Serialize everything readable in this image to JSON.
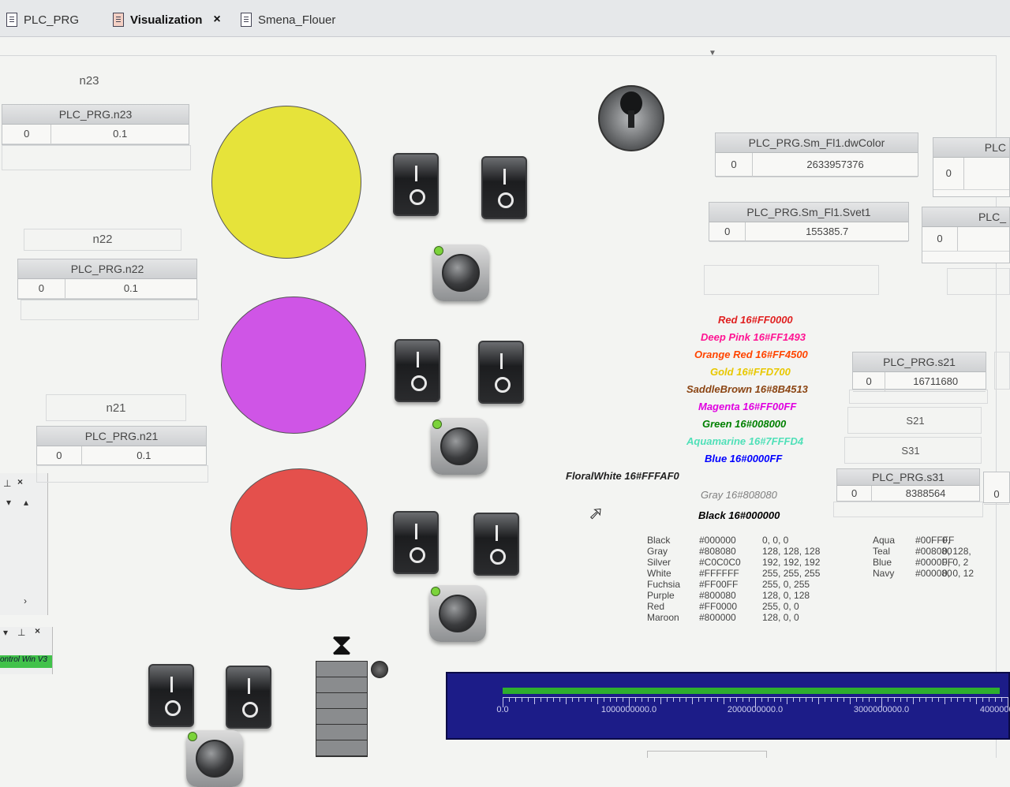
{
  "tabs": [
    {
      "label": "PLC_PRG",
      "active": false
    },
    {
      "label": "Visualization",
      "active": true
    },
    {
      "label": "Smena_Flouer",
      "active": false
    }
  ],
  "close_glyph": "×",
  "left_dock": {
    "status_text": "ontrol Win V3",
    "pin_glyph": "⊥",
    "close_glyph": "×"
  },
  "labels": {
    "n23": "n23",
    "n22": "n22",
    "n21": "n21",
    "S21": "S21",
    "S31": "S31"
  },
  "tables": {
    "n23": {
      "header": "PLC_PRG.n23",
      "index": "0",
      "value": "0.1"
    },
    "n22": {
      "header": "PLC_PRG.n22",
      "index": "0",
      "value": "0.1"
    },
    "n21": {
      "header": "PLC_PRG.n21",
      "index": "0",
      "value": "0.1"
    },
    "dwColor": {
      "header": "PLC_PRG.Sm_Fl1.dwColor",
      "index": "0",
      "value": "2633957376"
    },
    "svet1": {
      "header": "PLC_PRG.Sm_Fl1.Svet1",
      "index": "0",
      "value": "155385.7"
    },
    "s21": {
      "header": "PLC_PRG.s21",
      "index": "0",
      "value": "16711680"
    },
    "s31": {
      "header": "PLC_PRG.s31",
      "index": "0",
      "value": "8388564"
    },
    "right_top": {
      "header": "PLC",
      "index": "0"
    },
    "right_mid": {
      "header": "PLC_",
      "index": "0"
    },
    "right_low": {
      "index": "0"
    }
  },
  "lamps": {
    "colors": [
      "#e6e33a",
      "#cf55e6",
      "#e4504c"
    ]
  },
  "color_list": [
    {
      "text": "Red 16#FF0000",
      "color": "#e02020"
    },
    {
      "text": "Deep Pink  16#FF1493",
      "color": "#ff1493"
    },
    {
      "text": "Orange Red 16#FF4500",
      "color": "#ff4500"
    },
    {
      "text": "Gold 16#FFD700",
      "color": "#e8c800"
    },
    {
      "text": "SaddleBrown 16#8B4513",
      "color": "#8b4513"
    },
    {
      "text": "Magenta 16#FF00FF",
      "color": "#e000e0"
    },
    {
      "text": "Green 16#008000",
      "color": "#008000"
    },
    {
      "text": "Aquamarine 16#7FFFD4",
      "color": "#4fe0b8"
    },
    {
      "text": "Blue 16#0000FF",
      "color": "#0000ff"
    },
    {
      "text": "FloralWhite 16#FFFAF0",
      "color": "#222222"
    },
    {
      "text": "Gray 16#808080",
      "color": "#808080"
    },
    {
      "text": "Black 16#000000",
      "color": "#000000"
    }
  ],
  "color_table_left": [
    {
      "name": "Black",
      "hex": "#000000",
      "rgb": "0, 0, 0"
    },
    {
      "name": "Gray",
      "hex": "#808080",
      "rgb": "128, 128, 128"
    },
    {
      "name": "Silver",
      "hex": "#C0C0C0",
      "rgb": "192, 192, 192"
    },
    {
      "name": "White",
      "hex": "#FFFFFF",
      "rgb": "255, 255, 255"
    },
    {
      "name": "Fuchsia",
      "hex": "#FF00FF",
      "rgb": "255, 0, 255"
    },
    {
      "name": "Purple",
      "hex": "#800080",
      "rgb": "128, 0, 128"
    },
    {
      "name": "Red",
      "hex": "#FF0000",
      "rgb": "255, 0, 0"
    },
    {
      "name": "Maroon",
      "hex": "#800000",
      "rgb": "128, 0, 0"
    }
  ],
  "color_table_right": [
    {
      "name": "Aqua",
      "hex": "#00FFFF",
      "rgb": "0,"
    },
    {
      "name": "Teal",
      "hex": "#008080",
      "rgb": "0, 128,"
    },
    {
      "name": "Blue",
      "hex": "#0000FF",
      "rgb": "0, 0, 2"
    },
    {
      "name": "Navy",
      "hex": "#000080",
      "rgb": "0, 0, 12"
    }
  ],
  "bar_graph": {
    "value": 3940000000,
    "max": 4000000000,
    "tick_labels": [
      "0.0",
      "1000000000.0",
      "2000000000.0",
      "3000000000.0",
      "4000000000.0"
    ]
  },
  "colors": {
    "accent": "#1c1c88",
    "bar_fill": "#2eae2e",
    "led_green": "#7bd33a"
  }
}
